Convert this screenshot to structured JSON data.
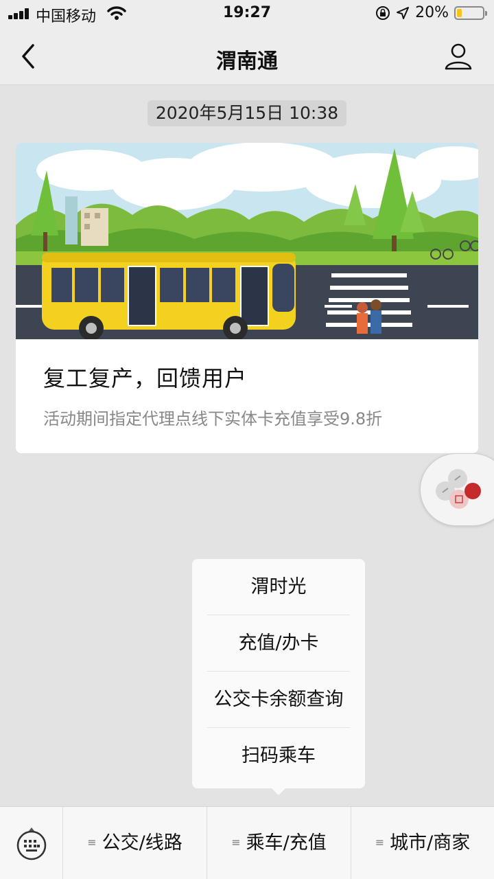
{
  "status_bar": {
    "carrier": "中国移动",
    "time": "19:27",
    "battery": "20%",
    "battery_level": 0.2
  },
  "nav": {
    "title": "渭南通",
    "back_icon": "chevron-left-icon",
    "profile_icon": "person-icon"
  },
  "chat": {
    "timestamp": "2020年5月15日 10:38",
    "article": {
      "title": "复工复产，回馈用户",
      "description": "活动期间指定代理点线下实体卡充值享受9.8折"
    }
  },
  "popup_menu": {
    "items": [
      "渭时光",
      "充值/办卡",
      "公交卡余额查询",
      "扫码乘车"
    ]
  },
  "bottom_bar": {
    "menus": [
      "公交/线路",
      "乘车/充值",
      "城市/商家"
    ]
  },
  "colors": {
    "bus_yellow": "#f2d21e",
    "battery_yellow": "#f5c518",
    "chat_background": "#e3e3e3"
  }
}
